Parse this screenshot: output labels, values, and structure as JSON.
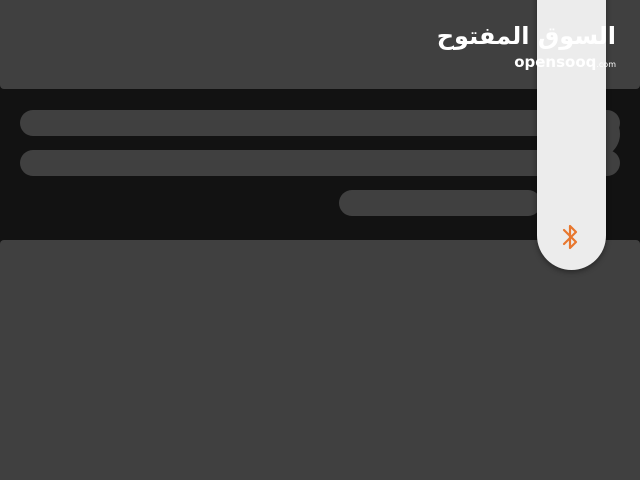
{
  "logo": {
    "arabic": "السوق المفتوح",
    "latin": "opensooq",
    "suffix": ".com"
  },
  "colors": {
    "background": "#121212",
    "skeleton": "#404040",
    "panel": "#ececec",
    "icon_accent": "#e8772e"
  },
  "icons": {
    "side_panel_icon": "bluetooth-icon"
  }
}
